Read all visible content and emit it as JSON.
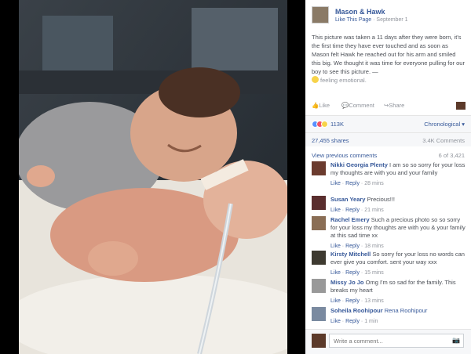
{
  "colors": {
    "accent": "#365899",
    "meta": "#90949c",
    "text": "#4b4f56"
  },
  "post": {
    "page_name": "Mason & Hawk",
    "like_page": "Like This Page",
    "date": "September 1",
    "text": "This picture was taken a 11 days after they were born, it's the first time they have ever touched and as soon as Mason felt Hawk he reached out for his arm and smiled this big. We thought it was time for everyone pulling for our boy to see this picture. —",
    "feeling": "feeling emotional."
  },
  "actions": {
    "like": "Like",
    "comment": "Comment",
    "share": "Share"
  },
  "reactions": {
    "count": "113K",
    "sort": "Chronological"
  },
  "stats": {
    "shares": "27,455 shares",
    "comments": "3.4K Comments"
  },
  "comments_header": {
    "view_previous": "View previous comments",
    "paging": "6 of 3,421"
  },
  "comments": [
    {
      "name": "Nikki Georgia Plenty",
      "text": "I am so so sorry for your loss my thoughts are with you and your family",
      "like": "Like",
      "reply": "Reply",
      "time": "28 mins"
    },
    {
      "name": "Susan Yeary",
      "text": "Precious!!!",
      "like": "Like",
      "reply": "Reply",
      "time": "21 mins"
    },
    {
      "name": "Rachel Emery",
      "text": "Such a precious photo so so sorry for your loss my thoughts are with you & your family at this sad time xx",
      "like": "Like",
      "reply": "Reply",
      "time": "18 mins"
    },
    {
      "name": "Kirsty Mitchell",
      "text": "So sorry for your loss no words can ever give you comfort. sent your way xxx",
      "like": "Like",
      "reply": "Reply",
      "time": "15 mins"
    },
    {
      "name": "Missy Jo Jo",
      "text": "Omg I'm so sad for the family. This breaks my heart",
      "like": "Like",
      "reply": "Reply",
      "time": "13 mins"
    },
    {
      "name": "Soheila Roohipour",
      "text": "Rena Roohipour",
      "like": "Like",
      "reply": "Reply",
      "time": "1 min"
    }
  ],
  "write": {
    "placeholder": "Write a comment..."
  }
}
